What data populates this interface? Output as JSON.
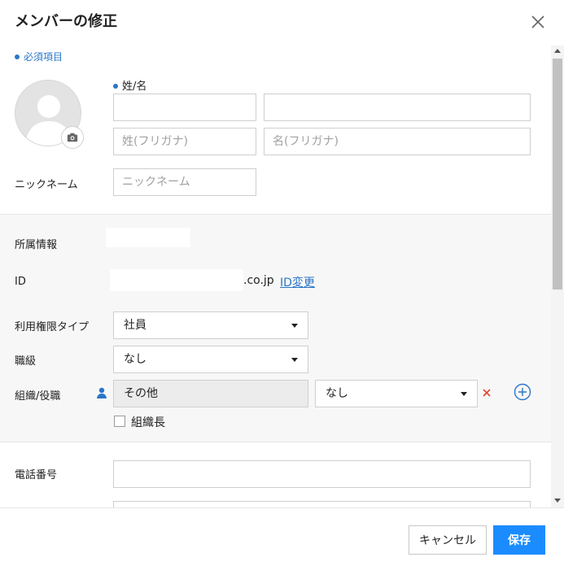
{
  "dialog": {
    "title": "メンバーの修正",
    "close_icon": "close-icon"
  },
  "form": {
    "required_note": "必須項目",
    "name_label": "姓/名",
    "last_name_value": "",
    "first_name_value": "",
    "last_name_kana_placeholder": "姓(フリガナ)",
    "first_name_kana_placeholder": "名(フリガナ)",
    "nickname_label": "ニックネーム",
    "nickname_placeholder": "ニックネーム",
    "affiliation_label": "所属情報",
    "id_label": "ID",
    "id_domain": ".co.jp",
    "id_change_link": "ID変更",
    "permission_type_label": "利用権限タイプ",
    "permission_type_value": "社員",
    "job_level_label": "職級",
    "job_level_value": "なし",
    "org_role_label": "組織/役職",
    "org_value": "その他",
    "role_value": "なし",
    "org_head_label": "組織長",
    "org_head_checked": false,
    "phone_label": "電話番号",
    "phone_value": ""
  },
  "footer": {
    "cancel_label": "キャンセル",
    "save_label": "保存"
  },
  "colors": {
    "accent": "#2a76c8",
    "primary_button": "#1a8cff",
    "remove": "#e0442e",
    "section_bg": "#f7f7f7"
  },
  "icons": [
    "close-icon",
    "camera-icon",
    "person-icon",
    "remove-icon",
    "add-circle-icon",
    "caret-down-icon"
  ]
}
